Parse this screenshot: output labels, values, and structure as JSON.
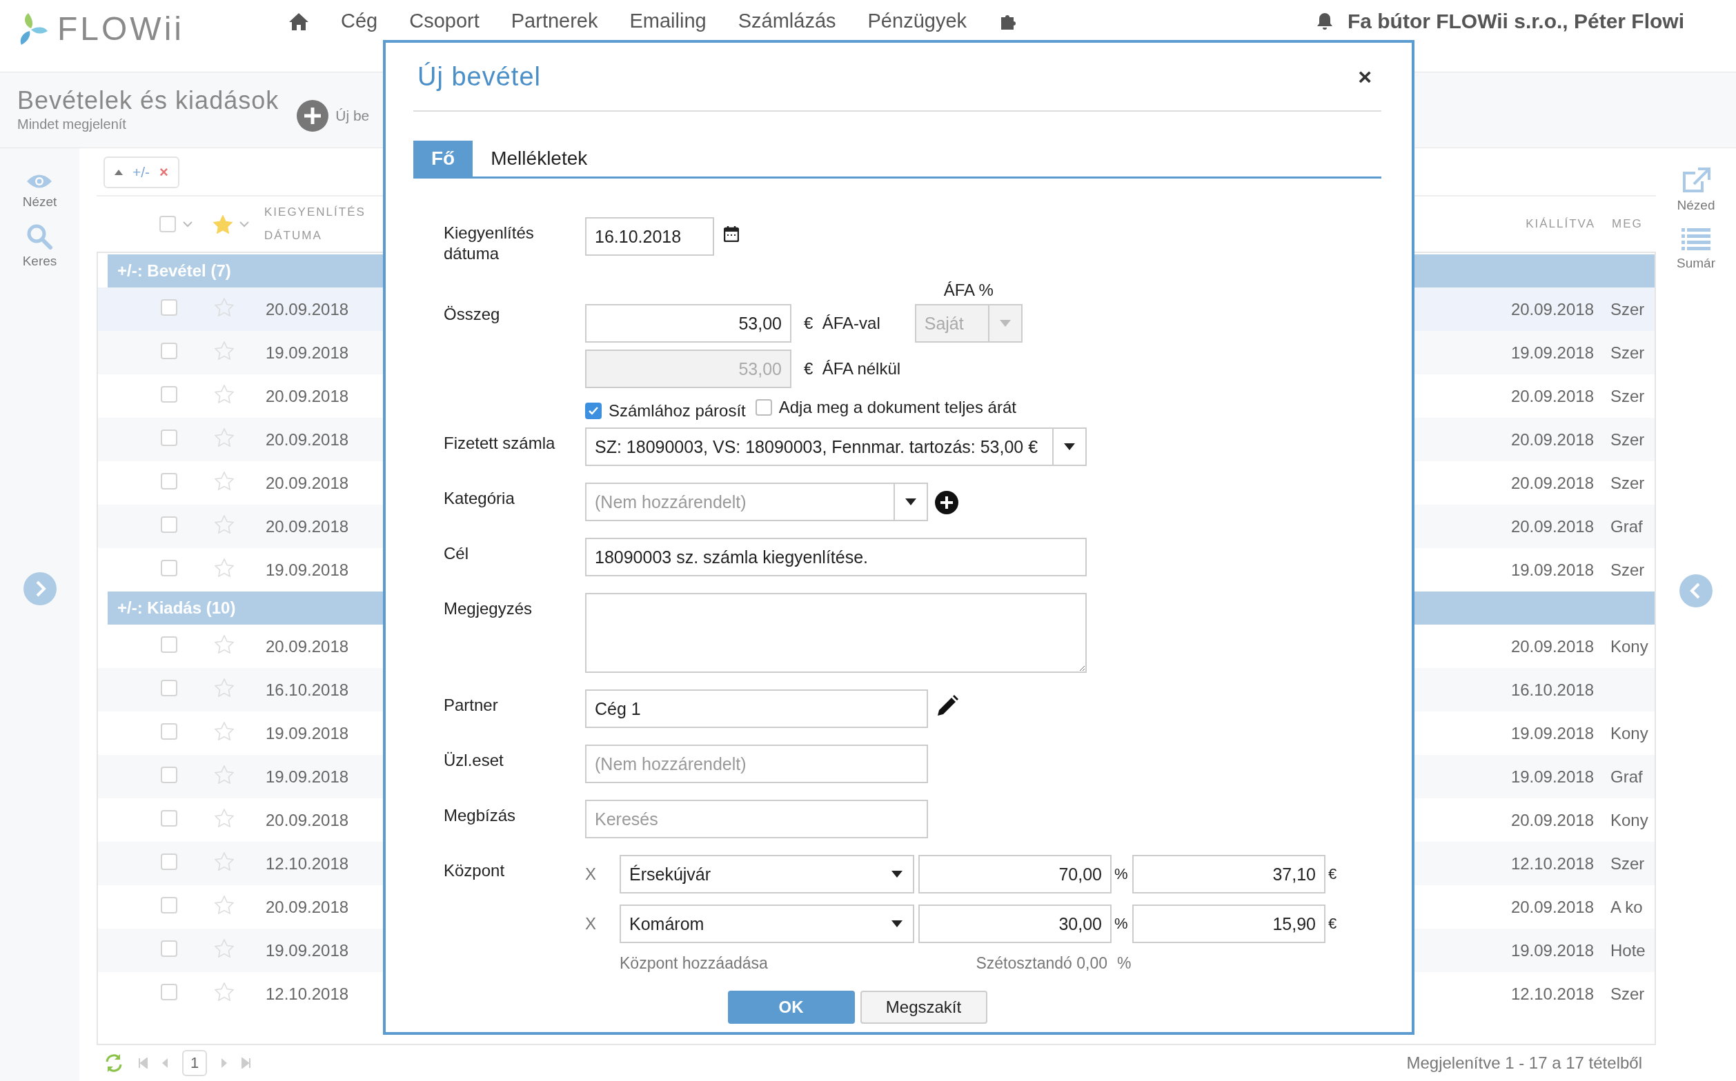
{
  "topbar": {
    "logo": "FLOWii",
    "nav": [
      "Cég",
      "Csoport",
      "Partnerek",
      "Emailing",
      "Számlázás",
      "Pénzügyek"
    ],
    "user": "Fa bútor FLOWii s.r.o., Péter Flowi"
  },
  "page": {
    "title": "Bevételek és kiadások",
    "subtitle": "Mindet megjelenít",
    "new_button": "Új be"
  },
  "left_sidebar": [
    {
      "label": "Nézet",
      "kind": "view"
    },
    {
      "label": "Keres",
      "kind": "search"
    }
  ],
  "right_sidebar": [
    {
      "label": "Nézed",
      "kind": "export"
    },
    {
      "label": "Sumár",
      "kind": "list"
    }
  ],
  "filter_chip": {
    "label": "+/-",
    "remove": "×"
  },
  "table": {
    "columns": [
      "KIEGYENLÍTÉS DÁTUMA",
      "KIÁLLÍTVA",
      "MEG"
    ],
    "all_checked": false,
    "groups": [
      {
        "label": "+/-: Bevétel (7)",
        "rows": [
          {
            "date": "20.09.2018",
            "issued": "20.09.2018",
            "column_3": "Szer",
            "checked": false
          },
          {
            "date": "19.09.2018",
            "issued": "19.09.2018",
            "column_3": "Szer",
            "checked": false
          },
          {
            "date": "20.09.2018",
            "issued": "20.09.2018",
            "column_3": "Szer",
            "checked": false
          },
          {
            "date": "20.09.2018",
            "issued": "20.09.2018",
            "column_3": "Szer",
            "checked": false
          },
          {
            "date": "20.09.2018",
            "issued": "20.09.2018",
            "column_3": "Szer",
            "checked": false
          },
          {
            "date": "20.09.2018",
            "issued": "20.09.2018",
            "column_3": "Graf",
            "checked": false
          },
          {
            "date": "19.09.2018",
            "issued": "19.09.2018",
            "column_3": "Szer",
            "checked": false
          }
        ]
      },
      {
        "label": "+/-: Kiadás (10)",
        "rows": [
          {
            "date": "20.09.2018",
            "issued": "20.09.2018",
            "column_3": "Kony",
            "checked": false
          },
          {
            "date": "16.10.2018",
            "issued": "16.10.2018",
            "checked": false
          },
          {
            "date": "19.09.2018",
            "issued": "19.09.2018",
            "column_3": "Kony",
            "checked": false
          },
          {
            "date": "19.09.2018",
            "issued": "19.09.2018",
            "column_3": "Graf",
            "checked": false
          },
          {
            "date": "20.09.2018",
            "issued": "20.09.2018",
            "column_3": "Kony",
            "checked": false
          },
          {
            "date": "12.10.2018",
            "issued": "12.10.2018",
            "column_3": "Szer",
            "checked": false
          },
          {
            "date": "20.09.2018",
            "issued": "20.09.2018",
            "column_3": "A ko",
            "checked": false
          },
          {
            "date": "19.09.2018",
            "issued": "19.09.2018",
            "column_3": "Hote",
            "checked": false
          },
          {
            "date": "12.10.2018",
            "issued": "12.10.2018",
            "column_3": "Szer",
            "checked": false
          }
        ]
      }
    ]
  },
  "pager": {
    "page": "1",
    "summary": "Megjelenítve 1 - 17 a 17 tételből"
  },
  "dialog": {
    "title": "Új bevétel",
    "close": "×",
    "tabs": [
      {
        "label": "Fő",
        "selected": true
      },
      {
        "label": "Mellékletek",
        "selected": false
      }
    ],
    "date": {
      "label": "Kiegyenlítés dátuma",
      "value": "16.10.2018"
    },
    "amount": {
      "label": "Összeg",
      "with_vat": {
        "value": "53,00",
        "unit": "€",
        "caption": "ÁFA-val",
        "disabled": false
      },
      "without_vat": {
        "value": "53,00",
        "unit": "€",
        "caption": "ÁFA nélkül",
        "disabled": true
      },
      "vat": {
        "label": "ÁFA %",
        "value": "Saját",
        "disabled": true
      }
    },
    "checkboxes": [
      {
        "label": "Számlához párosít",
        "checked": true
      },
      {
        "label": "Adja meg a dokument teljes árát",
        "checked": false
      }
    ],
    "invoice": {
      "label": "Fizetett számla",
      "value": "SZ: 18090003, VS: 18090003, Fennmar. tartozás: 53,00 €"
    },
    "category": {
      "label": "Kategória",
      "placeholder": "(Nem hozzárendelt)"
    },
    "purpose": {
      "label": "Cél",
      "value": "18090003 sz. számla kiegyenlítése."
    },
    "note": {
      "label": "Megjegyzés"
    },
    "partner": {
      "label": "Partner",
      "value": "Cég 1"
    },
    "business_case": {
      "label": "Üzl.eset",
      "placeholder": "(Nem hozzárendelt)"
    },
    "order": {
      "label": "Megbízás",
      "placeholder": "Keresés"
    },
    "centers": {
      "label": "Központ",
      "rows": [
        {
          "remove": "X",
          "name": "Érsekújvár",
          "percent": "70,00",
          "percent_unit": "%",
          "amount": "37,10",
          "currency": "€"
        },
        {
          "remove": "X",
          "name": "Komárom",
          "percent": "30,00",
          "percent_unit": "%",
          "amount": "15,90",
          "currency": "€"
        }
      ],
      "add_link": "Központ hozzáadása",
      "remaining": "Szétosztandó 0,00",
      "remaining_unit": "%"
    },
    "buttons": [
      {
        "label": "OK",
        "kind": "primary"
      },
      {
        "label": "Megszakít",
        "kind": "secondary"
      }
    ]
  }
}
